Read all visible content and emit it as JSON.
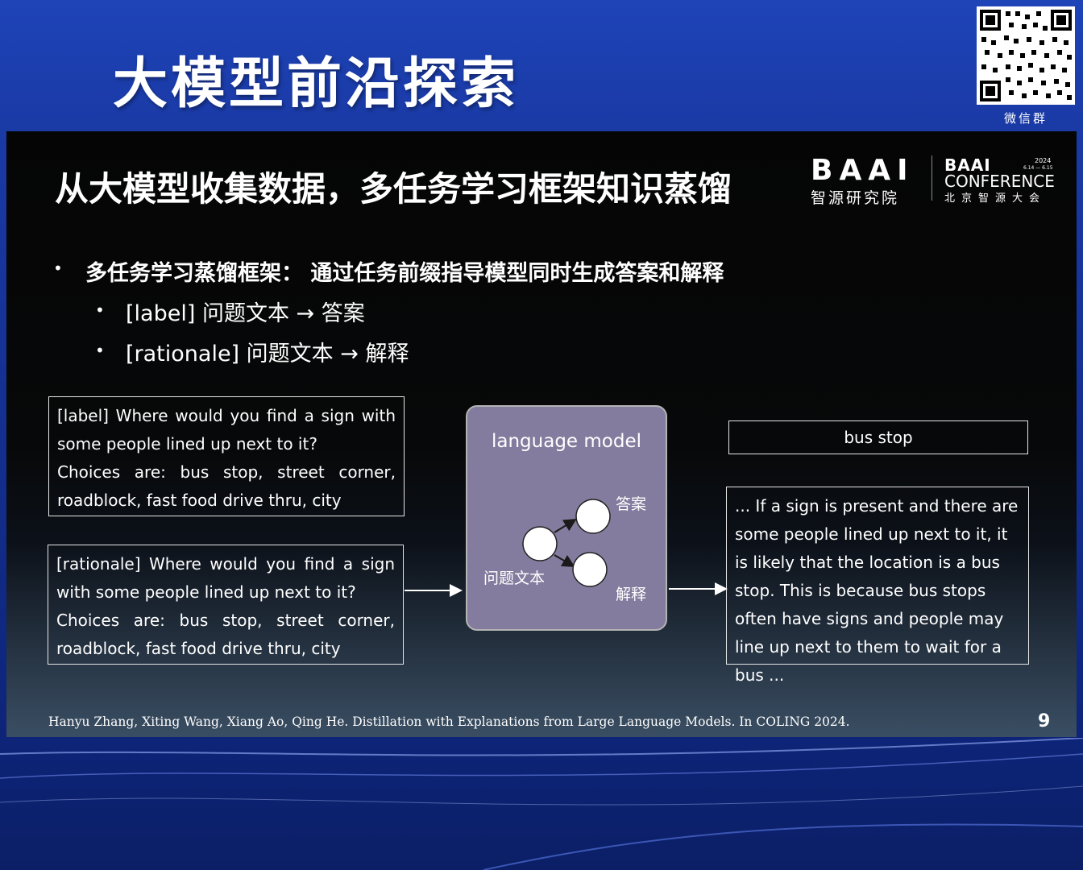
{
  "stage": {
    "title": "大模型前沿探索",
    "qr_caption": "微信群"
  },
  "slide": {
    "title": "从大模型收集数据，多任务学习框架知识蒸馏",
    "logo": {
      "baai_word": "BAAI",
      "baai_sub": "智源研究院",
      "conf_word": "BAAI",
      "conf_year": "2024",
      "conf_dates": "6.14 — 6.15",
      "conf_name": "CONFERENCE",
      "conf_sub": "北京智源大会"
    },
    "bullets": [
      {
        "dot": "•",
        "text": "多任务学习蒸馏框架：   通过任务前缀指导模型同时生成答案和解释"
      },
      {
        "dot": "•",
        "text": "[label] 问题文本 → 答案"
      },
      {
        "dot": "•",
        "text": "[rationale] 问题文本 → 解释"
      }
    ],
    "input_label": {
      "line1": "[label]  Where  would  you  find  a  sign  with some people lined up next to it?",
      "line2": "Choices   are:   bus  stop,  street  corner, roadblock, fast food drive thru, city"
    },
    "input_rationale": {
      "line1": "[rationale] Where would you find a sign with some people lined up next to it?",
      "line2": "Choices   are:   bus  stop,  street  corner, roadblock, fast food drive thru, city"
    },
    "model": {
      "title": "language model",
      "node_question": "问题文本",
      "node_answer": "答案",
      "node_rationale": "解释"
    },
    "output_answer": "bus stop",
    "output_rationale": "... If a sign is present and there are some people lined up next to it, it is likely that the location is a bus stop. This is because bus stops often have signs and people may line up next to them to wait for a bus ...",
    "footnote": "Hanyu Zhang, Xiting Wang, Xiang Ao, Qing He. Distillation with Explanations from Large Language Models. In COLING 2024.",
    "page_number": "9"
  },
  "colors": {
    "stage_blue": "#1e44b8",
    "slide_black": "#050505",
    "model_purple": "#847c9e"
  }
}
